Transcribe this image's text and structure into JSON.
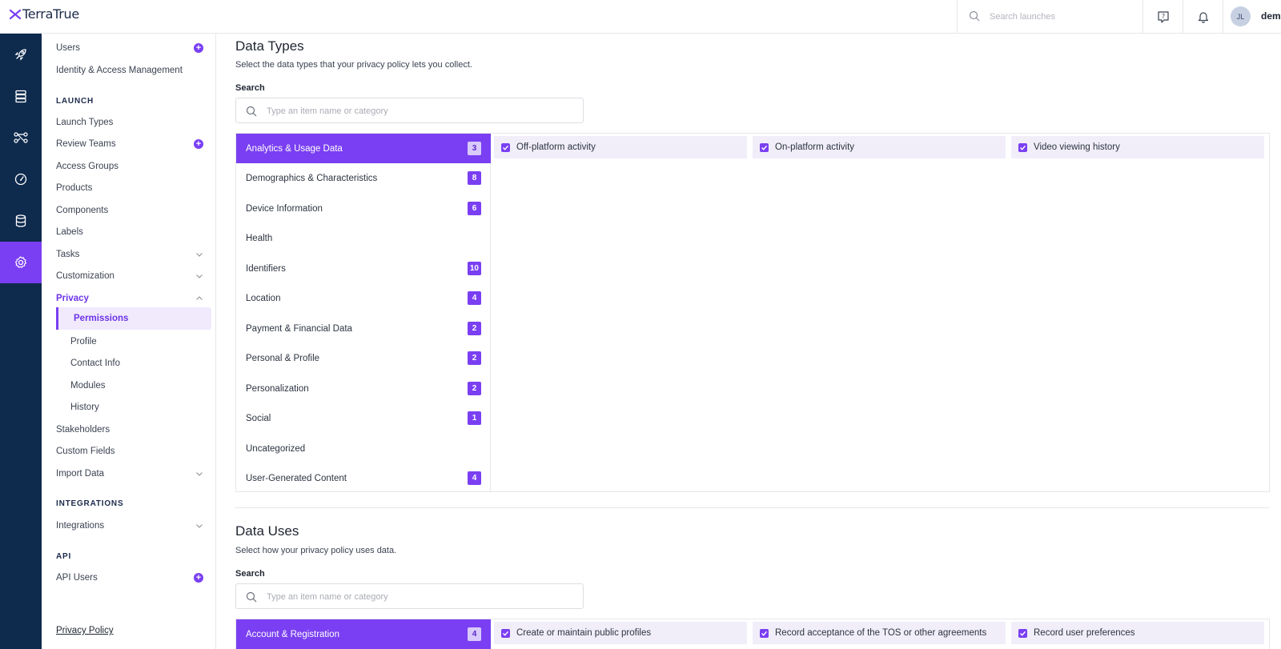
{
  "app": {
    "brand": "TerraTrue",
    "brand_color": "#7a3ff2",
    "rail_color": "#0e2a4d"
  },
  "topbar": {
    "search_placeholder": "Search launches",
    "help_icon": "help-chat-icon",
    "bell_icon": "bell-icon",
    "avatar_initials": "JL",
    "username": "demo"
  },
  "rail": {
    "items": [
      "rocket-icon",
      "server-icon",
      "share-nodes-icon",
      "gauge-icon",
      "database-icon",
      "gear-icon"
    ],
    "active": "gear-icon"
  },
  "nav": {
    "items_top": [
      "Users",
      "Identity & Access Management"
    ],
    "launch_section": "LAUNCH",
    "launch_items": [
      "Launch Types",
      "Review Teams",
      "Access Groups",
      "Products",
      "Components",
      "Labels",
      "Tasks",
      "Customization",
      "Privacy"
    ],
    "privacy_sub": [
      "Permissions",
      "Profile",
      "Contact Info",
      "Modules",
      "History"
    ],
    "after_items": [
      "Stakeholders",
      "Custom Fields",
      "Import Data"
    ],
    "integrations_section": "INTEGRATIONS",
    "integrations_items": [
      "Integrations"
    ],
    "api_section": "API",
    "api_items": [
      "API Users"
    ],
    "footer": "Privacy Policy"
  },
  "data_types": {
    "title": "Data Types",
    "description": "Select the data types that your privacy policy lets you collect.",
    "search_label": "Search",
    "search_placeholder": "Type an item name or category",
    "categories": [
      {
        "label": "Analytics & Usage Data",
        "count": "3"
      },
      {
        "label": "Demographics & Characteristics",
        "count": "8"
      },
      {
        "label": "Device Information",
        "count": "6"
      },
      {
        "label": "Health",
        "count": ""
      },
      {
        "label": "Identifiers",
        "count": "10"
      },
      {
        "label": "Location",
        "count": "4"
      },
      {
        "label": "Payment & Financial Data",
        "count": "2"
      },
      {
        "label": "Personal & Profile",
        "count": "2"
      },
      {
        "label": "Personalization",
        "count": "2"
      },
      {
        "label": "Social",
        "count": "1"
      },
      {
        "label": "Uncategorized",
        "count": ""
      },
      {
        "label": "User-Generated Content",
        "count": "4"
      }
    ],
    "active_category": "Analytics & Usage Data",
    "options": [
      "Off-platform activity",
      "On-platform activity",
      "Video viewing history"
    ]
  },
  "data_uses": {
    "title": "Data Uses",
    "description": "Select how your privacy policy uses data.",
    "search_label": "Search",
    "search_placeholder": "Type an item name or category",
    "categories": [
      {
        "label": "Account & Registration",
        "count": "4"
      }
    ],
    "active_category": "Account & Registration",
    "options": [
      "Create or maintain public profiles",
      "Record acceptance of the TOS or other agreements",
      "Record user preferences"
    ]
  }
}
